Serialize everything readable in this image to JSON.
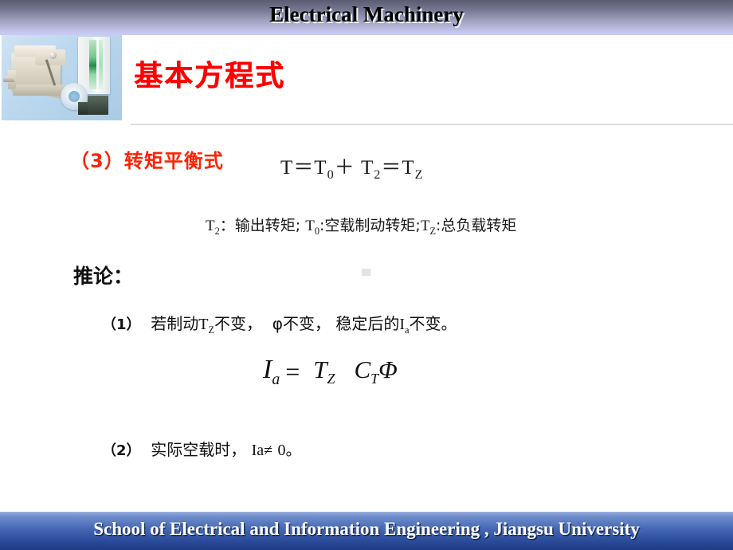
{
  "header": {
    "title": "Electrical Machinery",
    "gradient_top": "#5b5c72",
    "gradient_bottom": "#c9cbf2"
  },
  "photo": {
    "alt_name": "electric-machine-photo"
  },
  "slide": {
    "heading": "基本方程式",
    "heading_color": "#fe0000"
  },
  "content": {
    "section_label": "（3）转矩平衡式",
    "section_label_color": "#fe2200",
    "torque_equation": {
      "t": "T",
      "eq1": "＝",
      "t0": "T",
      "t0_sub": "0",
      "plus": "＋",
      "t2": "T",
      "t2_sub": "2",
      "eq2": "＝",
      "tz": "T",
      "tz_sub": "Z"
    },
    "symbol_legend": {
      "s1": "T",
      "s1_sub": "2",
      "s1_text": "：输出转矩;",
      "s2": "T",
      "s2_sub": "0",
      "s2_text": ":空载制动转矩;",
      "s3": "T",
      "s3_sub": "Z",
      "s3_text": ":总负载转矩"
    },
    "inference_label": "推论：",
    "point_1": {
      "number": "（1）",
      "text_a": "若制动",
      "sym_t": "T",
      "sym_t_sub": "Z",
      "text_b": "不变，",
      "phi": "φ",
      "text_c": "不变，",
      "text_d": "稳定后的",
      "sym_i": "I",
      "sym_i_sub": "a",
      "text_e": "不变。"
    },
    "formula": {
      "lhs": "I",
      "lhs_sub": "a",
      "equals": "=",
      "numerator": "T",
      "numerator_sub": "Z",
      "denominator": "C",
      "denominator_sub": "T",
      "denominator_phi": "Φ"
    },
    "point_2": {
      "number": "（2）",
      "text_a": "实际空载时，",
      "sym": "Ia",
      "neq": "≠",
      "zero": "0",
      "period": "。"
    }
  },
  "footer": {
    "text": "School of Electrical and Information Engineering , Jiangsu University",
    "gradient_top": "#9bb0dd",
    "gradient_bottom": "#203c84"
  }
}
